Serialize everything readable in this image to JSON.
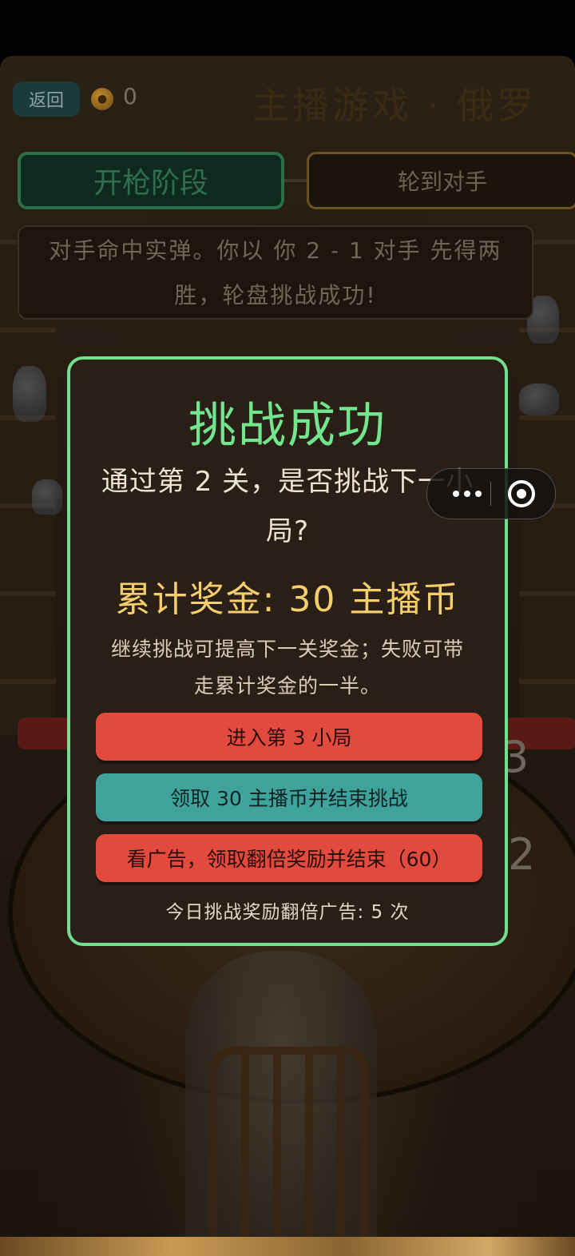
{
  "header": {
    "back_label": "返回",
    "coin_count": "0",
    "title": "主播游戏 · 俄罗"
  },
  "status": {
    "phase_label": "开枪阶段",
    "turn_label": "轮到对手",
    "message": "对手命中实弹。你以 你 2 - 1 对手 先得两胜，轮盘挑战成功!"
  },
  "background": {
    "digit_top": "3",
    "digit_bottom": "2"
  },
  "modal": {
    "title": "挑战成功",
    "question": "通过第 2 关，是否挑战下一小局?",
    "prize": "累计奖金: 30 主播币",
    "note": "继续挑战可提高下一关奖金；失败可带走累计奖金的一半。",
    "next_button": "进入第 3 小局",
    "claim_button": "领取 30 主播币并结束挑战",
    "ad_button": "看广告，领取翻倍奖励并结束（60）",
    "footer": "今日挑战奖励翻倍广告: 5 次"
  },
  "colors": {
    "modal_border": "#72df8f",
    "modal_title": "#72e58d",
    "prize": "#f6cf6c",
    "red_button": "#e24a3e",
    "teal_button": "#3fa39b"
  },
  "icons": {
    "coin": "coin-icon",
    "more": "more-dots-icon",
    "close": "close-circle-icon"
  }
}
